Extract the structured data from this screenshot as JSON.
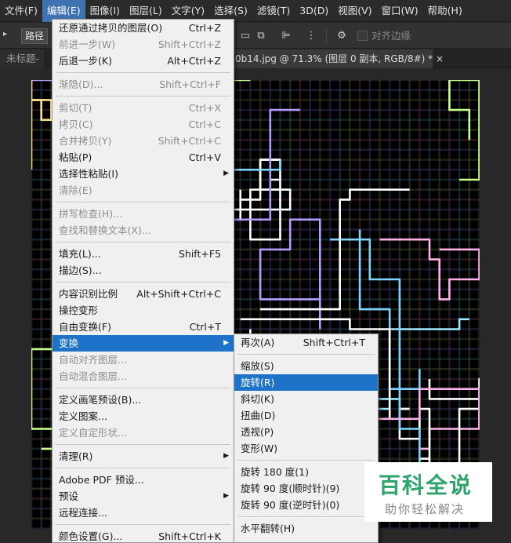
{
  "menubar": {
    "items": [
      "文件(F)",
      "编辑(E)",
      "图像(I)",
      "图层(L)",
      "文字(Y)",
      "选择(S)",
      "滤镜(T)",
      "3D(D)",
      "视图(V)",
      "窗口(W)",
      "帮助(H)"
    ],
    "active_index": 1
  },
  "options": {
    "select_value": "路径",
    "checkbox_label": "对齐边缘"
  },
  "tabs": {
    "untitled": "未标题-",
    "active": "0b14.jpg @ 71.3% (图层 0 副本, RGB/8#) *  ×"
  },
  "edit_menu": {
    "items": [
      {
        "label": "还原通过拷贝的图层(O)",
        "shortcut": "Ctrl+Z",
        "disabled": false
      },
      {
        "label": "前进一步(W)",
        "shortcut": "Shift+Ctrl+Z",
        "disabled": true
      },
      {
        "label": "后退一步(K)",
        "shortcut": "Alt+Ctrl+Z",
        "disabled": false
      },
      {
        "sep": true
      },
      {
        "label": "渐隐(D)...",
        "shortcut": "Shift+Ctrl+F",
        "disabled": true
      },
      {
        "sep": true
      },
      {
        "label": "剪切(T)",
        "shortcut": "Ctrl+X",
        "disabled": true
      },
      {
        "label": "拷贝(C)",
        "shortcut": "Ctrl+C",
        "disabled": true
      },
      {
        "label": "合并拷贝(Y)",
        "shortcut": "Shift+Ctrl+C",
        "disabled": true
      },
      {
        "label": "粘贴(P)",
        "shortcut": "Ctrl+V",
        "disabled": false
      },
      {
        "label": "选择性粘贴(I)",
        "shortcut": "",
        "disabled": false,
        "submenu": true
      },
      {
        "label": "清除(E)",
        "shortcut": "",
        "disabled": true
      },
      {
        "sep": true
      },
      {
        "label": "拼写检查(H)...",
        "shortcut": "",
        "disabled": true
      },
      {
        "label": "查找和替换文本(X)...",
        "shortcut": "",
        "disabled": true
      },
      {
        "sep": true
      },
      {
        "label": "填充(L)...",
        "shortcut": "Shift+F5",
        "disabled": false
      },
      {
        "label": "描边(S)...",
        "shortcut": "",
        "disabled": false
      },
      {
        "sep": true
      },
      {
        "label": "内容识别比例",
        "shortcut": "Alt+Shift+Ctrl+C",
        "disabled": false
      },
      {
        "label": "操控变形",
        "shortcut": "",
        "disabled": false
      },
      {
        "label": "自由变换(F)",
        "shortcut": "Ctrl+T",
        "disabled": false
      },
      {
        "label": "变换",
        "shortcut": "",
        "disabled": false,
        "submenu": true,
        "highlight": true
      },
      {
        "label": "自动对齐图层...",
        "shortcut": "",
        "disabled": true
      },
      {
        "label": "自动混合图层...",
        "shortcut": "",
        "disabled": true
      },
      {
        "sep": true
      },
      {
        "label": "定义画笔预设(B)...",
        "shortcut": "",
        "disabled": false
      },
      {
        "label": "定义图案...",
        "shortcut": "",
        "disabled": false
      },
      {
        "label": "定义自定形状...",
        "shortcut": "",
        "disabled": true
      },
      {
        "sep": true
      },
      {
        "label": "清理(R)",
        "shortcut": "",
        "disabled": false,
        "submenu": true
      },
      {
        "sep": true
      },
      {
        "label": "Adobe PDF 预设...",
        "shortcut": "",
        "disabled": false
      },
      {
        "label": "预设",
        "shortcut": "",
        "disabled": false,
        "submenu": true
      },
      {
        "label": "远程连接...",
        "shortcut": "",
        "disabled": false
      },
      {
        "sep": true
      },
      {
        "label": "颜色设置(G)...",
        "shortcut": "Shift+Ctrl+K",
        "disabled": false
      }
    ]
  },
  "transform_menu": {
    "items": [
      {
        "label": "再次(A)",
        "shortcut": "Shift+Ctrl+T"
      },
      {
        "sep": true
      },
      {
        "label": "缩放(S)",
        "shortcut": ""
      },
      {
        "label": "旋转(R)",
        "shortcut": "",
        "highlight": true
      },
      {
        "label": "斜切(K)",
        "shortcut": ""
      },
      {
        "label": "扭曲(D)",
        "shortcut": ""
      },
      {
        "label": "透视(P)",
        "shortcut": ""
      },
      {
        "label": "变形(W)",
        "shortcut": ""
      },
      {
        "sep": true
      },
      {
        "label": "旋转 180 度(1)",
        "shortcut": ""
      },
      {
        "label": "旋转 90 度(顺时针)(9)",
        "shortcut": ""
      },
      {
        "label": "旋转 90 度(逆时针)(0)",
        "shortcut": ""
      },
      {
        "sep": true
      },
      {
        "label": "水平翻转(H)",
        "shortcut": ""
      }
    ]
  },
  "watermark": {
    "title": "百科全说",
    "subtitle": "助你轻松解决"
  },
  "colors": {
    "menu_highlight": "#1e72c8",
    "menubar_active": "#3f72b0",
    "watermark_green": "#2ea36b"
  }
}
